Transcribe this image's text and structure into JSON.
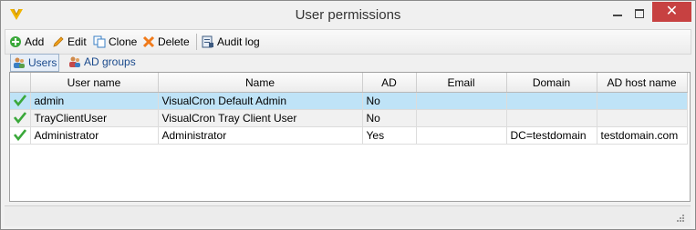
{
  "window": {
    "title": "User permissions",
    "close_glyph": "✕",
    "accent_color": "#c74141"
  },
  "toolbar": {
    "buttons": [
      {
        "label": "Add",
        "icon": "add-icon"
      },
      {
        "label": "Edit",
        "icon": "pencil-icon"
      },
      {
        "label": "Clone",
        "icon": "clone-icon"
      },
      {
        "label": "Delete",
        "icon": "delete-icon"
      },
      {
        "label": "Audit log",
        "icon": "audit-log-icon"
      }
    ]
  },
  "tabs": [
    {
      "label": "Users",
      "icon": "users-icon",
      "active": true
    },
    {
      "label": "AD groups",
      "icon": "ad-groups-icon",
      "active": false
    }
  ],
  "table": {
    "columns": [
      "User name",
      "Name",
      "AD",
      "Email",
      "Domain",
      "AD host name"
    ],
    "rows": [
      {
        "user_name": "admin",
        "name": "VisualCron Default Admin",
        "ad": "No",
        "email": "",
        "domain": "",
        "ad_host_name": "",
        "enabled": true
      },
      {
        "user_name": "TrayClientUser",
        "name": "VisualCron Tray Client User",
        "ad": "No",
        "email": "",
        "domain": "",
        "ad_host_name": "",
        "enabled": true
      },
      {
        "user_name": "Administrator",
        "name": "Administrator",
        "ad": "Yes",
        "email": "",
        "domain": "DC=testdomain",
        "ad_host_name": "testdomain.com",
        "enabled": true
      }
    ],
    "selected_row": 0,
    "selected_color": "#bfe3f7"
  }
}
